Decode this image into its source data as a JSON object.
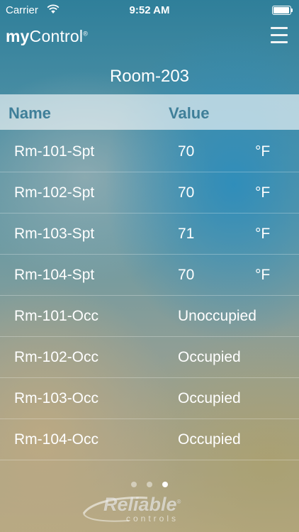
{
  "status_bar": {
    "carrier": "Carrier",
    "time": "9:52 AM"
  },
  "nav": {
    "logo_my": "my",
    "logo_control": "Control",
    "logo_mark": "®"
  },
  "page_title": "Room-203",
  "table": {
    "headers": {
      "name": "Name",
      "value": "Value"
    },
    "rows": [
      {
        "name": "Rm-101-Spt",
        "value": "70",
        "unit": "°F"
      },
      {
        "name": "Rm-102-Spt",
        "value": "70",
        "unit": "°F"
      },
      {
        "name": "Rm-103-Spt",
        "value": "71",
        "unit": "°F"
      },
      {
        "name": "Rm-104-Spt",
        "value": "70",
        "unit": "°F"
      },
      {
        "name": "Rm-101-Occ",
        "value": "Unoccupied",
        "unit": ""
      },
      {
        "name": "Rm-102-Occ",
        "value": "Occupied",
        "unit": ""
      },
      {
        "name": "Rm-103-Occ",
        "value": "Occupied",
        "unit": ""
      },
      {
        "name": "Rm-104-Occ",
        "value": "Occupied",
        "unit": ""
      }
    ]
  },
  "page_indicator": {
    "total": 3,
    "current": 3
  },
  "footer": {
    "brand": "Reliable",
    "brand_mark": "®",
    "sub": "controls"
  },
  "icons": {
    "wifi": "wifi-icon",
    "battery": "battery-icon",
    "menu": "hamburger-menu-icon"
  },
  "colors": {
    "header_text": "#3f7f99",
    "text": "#ffffff"
  }
}
